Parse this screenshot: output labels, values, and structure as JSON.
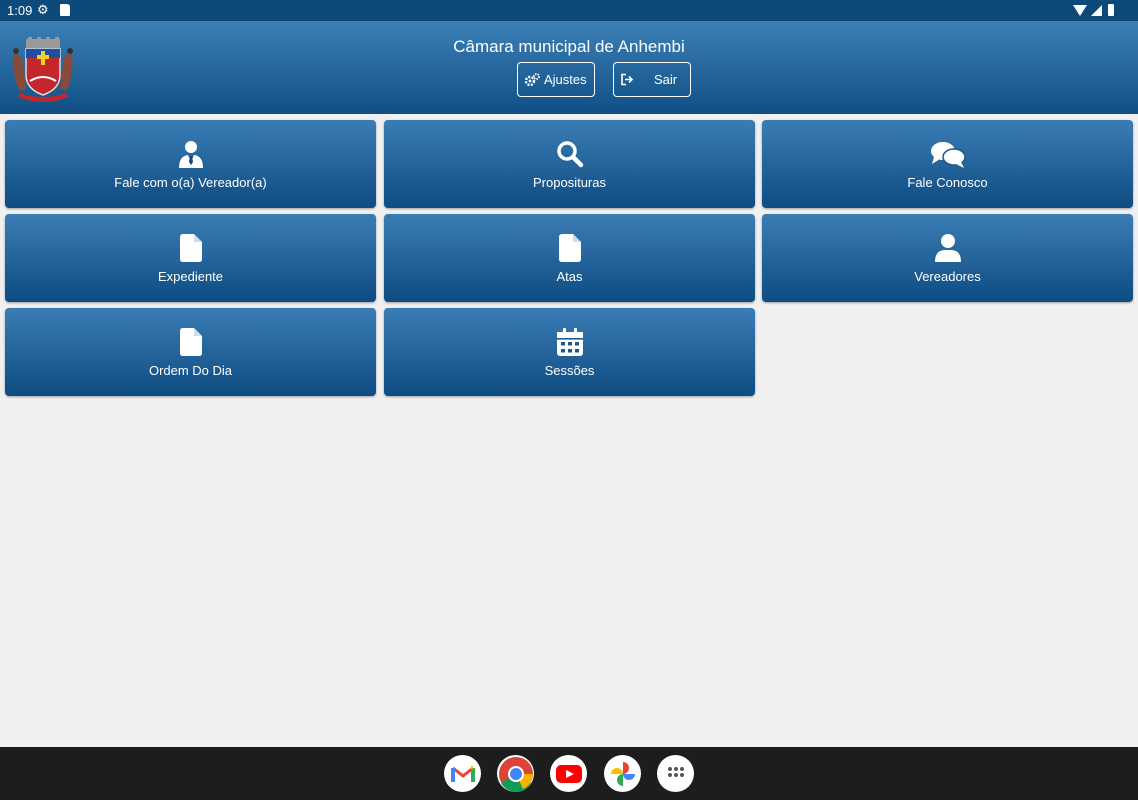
{
  "status_bar": {
    "time": "1:09"
  },
  "header": {
    "title": "Câmara municipal de Anhembi",
    "settings_label": "Ajustes",
    "logout_label": "Sair"
  },
  "tiles": [
    {
      "label": "Fale com o(a) Vereador(a)",
      "icon": "user-tie-icon"
    },
    {
      "label": "Proposituras",
      "icon": "search-icon"
    },
    {
      "label": "Fale Conosco",
      "icon": "comments-icon"
    },
    {
      "label": "Expediente",
      "icon": "document-icon"
    },
    {
      "label": "Atas",
      "icon": "document-icon"
    },
    {
      "label": "Vereadores",
      "icon": "user-icon"
    },
    {
      "label": "Ordem Do Dia",
      "icon": "document-icon"
    },
    {
      "label": "Sessões",
      "icon": "calendar-icon"
    }
  ],
  "dock": [
    {
      "icon": "gmail-icon"
    },
    {
      "icon": "chrome-icon"
    },
    {
      "icon": "youtube-icon"
    },
    {
      "icon": "photos-icon"
    },
    {
      "icon": "apps-icon"
    }
  ],
  "colors": {
    "status_bar": "#0d4a7c",
    "header_top": "#3c80b6",
    "header_bottom": "#0f4f86",
    "tile_top": "#3a7db4",
    "tile_bottom": "#0e4c83",
    "background": "#f0f0f0",
    "nav_bar": "#1d1d1d"
  }
}
